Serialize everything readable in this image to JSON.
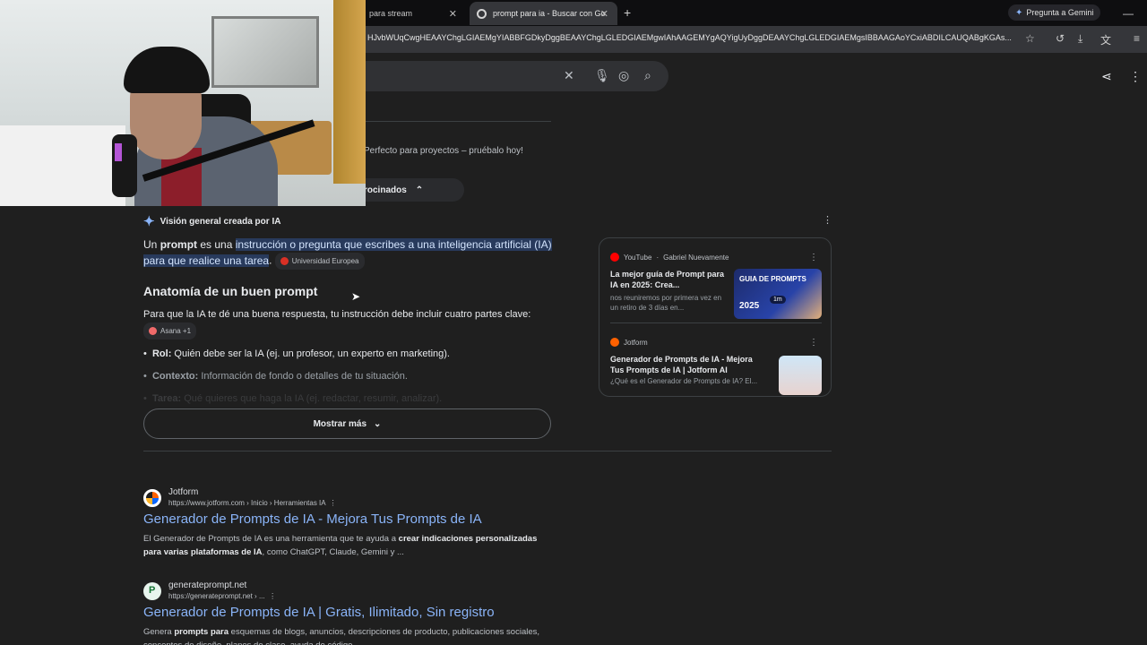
{
  "browser": {
    "tabs": [
      {
        "label": "para stream",
        "active": false
      },
      {
        "label": "prompt para ia - Buscar con Go",
        "active": true
      }
    ],
    "new_tab": "+",
    "gemini_label": "Pregunta a Gemini",
    "url": "HJvbWUqCwgHEAAYChgLGIAEMgYIABBFGDkyDggBEAAYChgLGLEDGIAEMgwIAhAAGEMYgAQYigUyDggDEAAYChgLGLEDGIAEMgsIBBAAGAoYCxiABDILCAUQABgKGAs..."
  },
  "search": {
    "clear_icon": "close-icon",
    "voice_icon": "microphone-icon",
    "lens_icon": "lens-icon",
    "search_icon": "search-icon"
  },
  "ads": {
    "text": "Perfecto para proyectos – pruébalo hoy!",
    "sponsored_label": "rocinados"
  },
  "ai_overview": {
    "header": "Visión general creada por IA",
    "intro_pre": "Un ",
    "intro_bold": "prompt",
    "intro_mid": " es una ",
    "intro_highlight": "instrucción o pregunta que escribes a una inteligencia artificial (IA) para que realice una tarea",
    "intro_post": ".",
    "intro_source": "Universidad Europea",
    "heading": "Anatomía de un buen prompt",
    "para": "Para que la IA te dé una buena respuesta, tu instrucción debe incluir cuatro partes clave:",
    "para_source": "Asana +1",
    "bullets": [
      {
        "bold": "Rol:",
        "text": " Quién debe ser la IA (ej. un profesor, un experto en marketing)."
      },
      {
        "bold": "Contexto:",
        "text": " Información de fondo o detalles de tu situación."
      },
      {
        "bold": "Tarea:",
        "text": " Qué quieres que haga la IA (ej. redactar, resumir, analizar)."
      }
    ],
    "show_more": "Mostrar más"
  },
  "side_cards": [
    {
      "source": "YouTube",
      "author": "Gabriel Nuevamente",
      "title": "La mejor guía de Prompt para IA en 2025: Crea...",
      "desc": "nos reuniremos por primera vez en un retiro de 3 días en...",
      "thumb_text": "GUIA DE PROMPTS",
      "thumb_year": "2025",
      "duration": "1m"
    },
    {
      "source": "Jotform",
      "title": "Generador de Prompts de IA - Mejora Tus Prompts de IA | Jotform AI",
      "desc": "¿Qué es el Generador de Prompts de IA? El..."
    }
  ],
  "results": [
    {
      "site": "Jotform",
      "cite": "https://www.jotform.com › Inicio › Herramientas IA",
      "title": "Generador de Prompts de IA - Mejora Tus Prompts de IA",
      "snippet_pre": "El Generador de Prompts de IA es una herramienta que te ayuda a ",
      "snippet_bold": "crear indicaciones personalizadas para varias plataformas de IA",
      "snippet_post": ", como ChatGPT, Claude, Gemini y ..."
    },
    {
      "site": "generateprompt.net",
      "cite": "https://generateprompt.net › ...",
      "title": "Generador de Prompts de IA | Gratis, Ilimitado, Sin registro",
      "snippet_pre": "Genera ",
      "snippet_bold": "prompts para",
      "snippet_post": " esquemas de blogs, anuncios, descripciones de producto, publicaciones sociales, conceptos de diseño, planes de clase, ayuda de código..."
    }
  ],
  "colors": {
    "link": "#8ab4f8",
    "highlight": "#283a5c",
    "background": "#1f1f1f"
  }
}
